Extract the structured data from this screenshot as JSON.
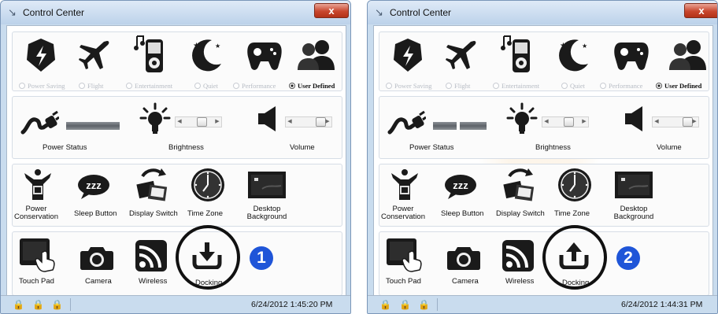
{
  "windows": [
    {
      "title": "Control Center",
      "close_label": "x",
      "modes": {
        "items": [
          "Power Saving",
          "Flight",
          "Entertainment",
          "Quiet",
          "Performance",
          "User Defined"
        ],
        "selected": "User Defined"
      },
      "status_row": {
        "power_status": "Power Status",
        "brightness": "Brightness",
        "volume": "Volume",
        "power_bar_segments": 1,
        "brightness_level": 0.55,
        "volume_level": 0.8
      },
      "buttons_row": {
        "power_conservation": "Power Conservation",
        "sleep_button": "Sleep Button",
        "display_switch": "Display Switch",
        "time_zone": "Time Zone",
        "desktop_background": "Desktop Background"
      },
      "devices_row": {
        "touch_pad": "Touch Pad",
        "camera": "Camera",
        "wireless": "Wireless",
        "docking": "Docking",
        "docking_arrow": "down"
      },
      "callout": "1",
      "datetime": "6/24/2012 1:45:20 PM"
    },
    {
      "title": "Control Center",
      "close_label": "x",
      "modes": {
        "items": [
          "Power Saving",
          "Flight",
          "Entertainment",
          "Quiet",
          "Performance",
          "User Defined"
        ],
        "selected": "User Defined"
      },
      "status_row": {
        "power_status": "Power Status",
        "brightness": "Brightness",
        "volume": "Volume",
        "power_bar_segments": 2,
        "brightness_level": 0.55,
        "volume_level": 0.8
      },
      "buttons_row": {
        "power_conservation": "Power Conservation",
        "sleep_button": "Sleep Button",
        "display_switch": "Display Switch",
        "time_zone": "Time Zone",
        "desktop_background": "Desktop Background"
      },
      "devices_row": {
        "touch_pad": "Touch Pad",
        "camera": "Camera",
        "wireless": "Wireless",
        "docking": "Docking",
        "docking_arrow": "up"
      },
      "callout": "2",
      "datetime": "6/24/2012 1:44:31 PM"
    }
  ],
  "colors": {
    "frame": "#c9dcee",
    "close_button": "#c8462d",
    "callout_badge": "#1f55d8"
  },
  "icons": [
    "app-icon",
    "power-saving-icon",
    "flight-icon",
    "entertainment-icon",
    "quiet-icon",
    "performance-icon",
    "user-defined-icon",
    "power-plug-icon",
    "brightness-icon",
    "volume-icon",
    "power-conservation-icon",
    "sleep-icon",
    "display-switch-icon",
    "time-zone-icon",
    "desktop-background-icon",
    "touch-pad-icon",
    "camera-icon",
    "wireless-icon",
    "docking-icon",
    "lock-icon"
  ]
}
